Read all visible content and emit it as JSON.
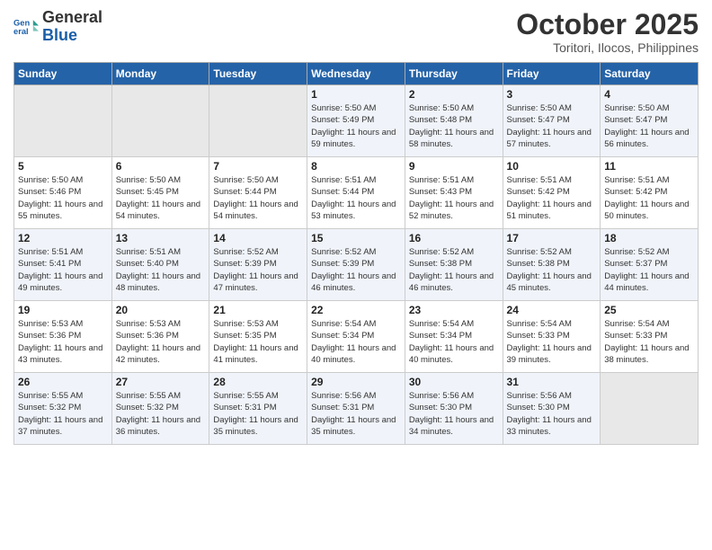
{
  "logo": {
    "line1": "General",
    "line2": "Blue"
  },
  "header": {
    "month": "October 2025",
    "location": "Toritori, Ilocos, Philippines"
  },
  "weekdays": [
    "Sunday",
    "Monday",
    "Tuesday",
    "Wednesday",
    "Thursday",
    "Friday",
    "Saturday"
  ],
  "weeks": [
    [
      {
        "day": "",
        "empty": true
      },
      {
        "day": "",
        "empty": true
      },
      {
        "day": "",
        "empty": true
      },
      {
        "day": "1",
        "sunrise": "Sunrise: 5:50 AM",
        "sunset": "Sunset: 5:49 PM",
        "daylight": "Daylight: 11 hours and 59 minutes."
      },
      {
        "day": "2",
        "sunrise": "Sunrise: 5:50 AM",
        "sunset": "Sunset: 5:48 PM",
        "daylight": "Daylight: 11 hours and 58 minutes."
      },
      {
        "day": "3",
        "sunrise": "Sunrise: 5:50 AM",
        "sunset": "Sunset: 5:47 PM",
        "daylight": "Daylight: 11 hours and 57 minutes."
      },
      {
        "day": "4",
        "sunrise": "Sunrise: 5:50 AM",
        "sunset": "Sunset: 5:47 PM",
        "daylight": "Daylight: 11 hours and 56 minutes."
      }
    ],
    [
      {
        "day": "5",
        "sunrise": "Sunrise: 5:50 AM",
        "sunset": "Sunset: 5:46 PM",
        "daylight": "Daylight: 11 hours and 55 minutes."
      },
      {
        "day": "6",
        "sunrise": "Sunrise: 5:50 AM",
        "sunset": "Sunset: 5:45 PM",
        "daylight": "Daylight: 11 hours and 54 minutes."
      },
      {
        "day": "7",
        "sunrise": "Sunrise: 5:50 AM",
        "sunset": "Sunset: 5:44 PM",
        "daylight": "Daylight: 11 hours and 54 minutes."
      },
      {
        "day": "8",
        "sunrise": "Sunrise: 5:51 AM",
        "sunset": "Sunset: 5:44 PM",
        "daylight": "Daylight: 11 hours and 53 minutes."
      },
      {
        "day": "9",
        "sunrise": "Sunrise: 5:51 AM",
        "sunset": "Sunset: 5:43 PM",
        "daylight": "Daylight: 11 hours and 52 minutes."
      },
      {
        "day": "10",
        "sunrise": "Sunrise: 5:51 AM",
        "sunset": "Sunset: 5:42 PM",
        "daylight": "Daylight: 11 hours and 51 minutes."
      },
      {
        "day": "11",
        "sunrise": "Sunrise: 5:51 AM",
        "sunset": "Sunset: 5:42 PM",
        "daylight": "Daylight: 11 hours and 50 minutes."
      }
    ],
    [
      {
        "day": "12",
        "sunrise": "Sunrise: 5:51 AM",
        "sunset": "Sunset: 5:41 PM",
        "daylight": "Daylight: 11 hours and 49 minutes."
      },
      {
        "day": "13",
        "sunrise": "Sunrise: 5:51 AM",
        "sunset": "Sunset: 5:40 PM",
        "daylight": "Daylight: 11 hours and 48 minutes."
      },
      {
        "day": "14",
        "sunrise": "Sunrise: 5:52 AM",
        "sunset": "Sunset: 5:39 PM",
        "daylight": "Daylight: 11 hours and 47 minutes."
      },
      {
        "day": "15",
        "sunrise": "Sunrise: 5:52 AM",
        "sunset": "Sunset: 5:39 PM",
        "daylight": "Daylight: 11 hours and 46 minutes."
      },
      {
        "day": "16",
        "sunrise": "Sunrise: 5:52 AM",
        "sunset": "Sunset: 5:38 PM",
        "daylight": "Daylight: 11 hours and 46 minutes."
      },
      {
        "day": "17",
        "sunrise": "Sunrise: 5:52 AM",
        "sunset": "Sunset: 5:38 PM",
        "daylight": "Daylight: 11 hours and 45 minutes."
      },
      {
        "day": "18",
        "sunrise": "Sunrise: 5:52 AM",
        "sunset": "Sunset: 5:37 PM",
        "daylight": "Daylight: 11 hours and 44 minutes."
      }
    ],
    [
      {
        "day": "19",
        "sunrise": "Sunrise: 5:53 AM",
        "sunset": "Sunset: 5:36 PM",
        "daylight": "Daylight: 11 hours and 43 minutes."
      },
      {
        "day": "20",
        "sunrise": "Sunrise: 5:53 AM",
        "sunset": "Sunset: 5:36 PM",
        "daylight": "Daylight: 11 hours and 42 minutes."
      },
      {
        "day": "21",
        "sunrise": "Sunrise: 5:53 AM",
        "sunset": "Sunset: 5:35 PM",
        "daylight": "Daylight: 11 hours and 41 minutes."
      },
      {
        "day": "22",
        "sunrise": "Sunrise: 5:54 AM",
        "sunset": "Sunset: 5:34 PM",
        "daylight": "Daylight: 11 hours and 40 minutes."
      },
      {
        "day": "23",
        "sunrise": "Sunrise: 5:54 AM",
        "sunset": "Sunset: 5:34 PM",
        "daylight": "Daylight: 11 hours and 40 minutes."
      },
      {
        "day": "24",
        "sunrise": "Sunrise: 5:54 AM",
        "sunset": "Sunset: 5:33 PM",
        "daylight": "Daylight: 11 hours and 39 minutes."
      },
      {
        "day": "25",
        "sunrise": "Sunrise: 5:54 AM",
        "sunset": "Sunset: 5:33 PM",
        "daylight": "Daylight: 11 hours and 38 minutes."
      }
    ],
    [
      {
        "day": "26",
        "sunrise": "Sunrise: 5:55 AM",
        "sunset": "Sunset: 5:32 PM",
        "daylight": "Daylight: 11 hours and 37 minutes."
      },
      {
        "day": "27",
        "sunrise": "Sunrise: 5:55 AM",
        "sunset": "Sunset: 5:32 PM",
        "daylight": "Daylight: 11 hours and 36 minutes."
      },
      {
        "day": "28",
        "sunrise": "Sunrise: 5:55 AM",
        "sunset": "Sunset: 5:31 PM",
        "daylight": "Daylight: 11 hours and 35 minutes."
      },
      {
        "day": "29",
        "sunrise": "Sunrise: 5:56 AM",
        "sunset": "Sunset: 5:31 PM",
        "daylight": "Daylight: 11 hours and 35 minutes."
      },
      {
        "day": "30",
        "sunrise": "Sunrise: 5:56 AM",
        "sunset": "Sunset: 5:30 PM",
        "daylight": "Daylight: 11 hours and 34 minutes."
      },
      {
        "day": "31",
        "sunrise": "Sunrise: 5:56 AM",
        "sunset": "Sunset: 5:30 PM",
        "daylight": "Daylight: 11 hours and 33 minutes."
      },
      {
        "day": "",
        "empty": true
      }
    ]
  ]
}
